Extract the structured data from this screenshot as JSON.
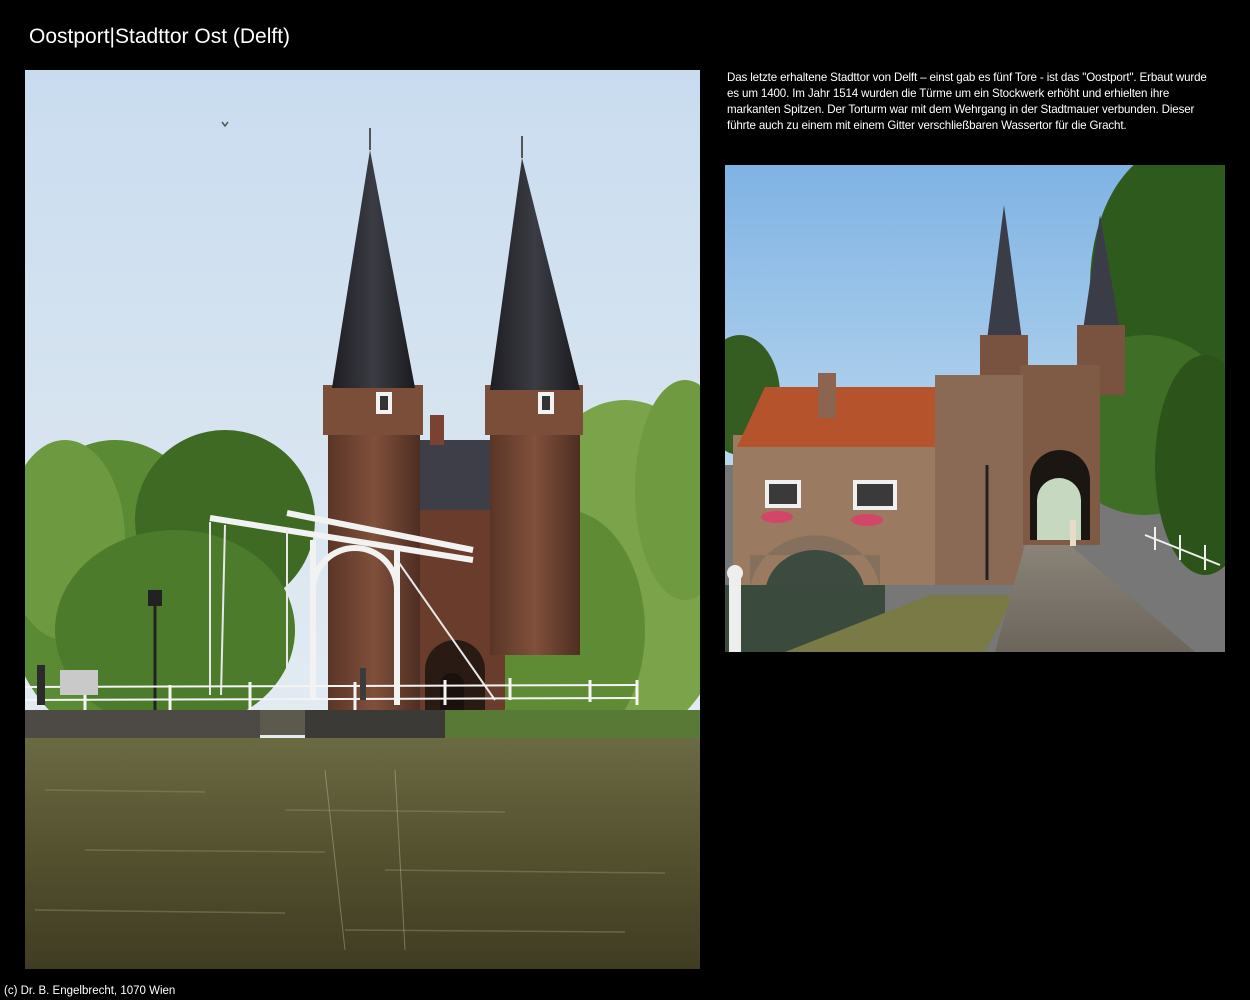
{
  "page": {
    "title": "Oostport|Stadttor Ost (Delft)"
  },
  "description": {
    "text": "Das letzte erhaltene Stadttor von Delft – einst gab es fünf Tore - ist das \"Oostport\". Erbaut wurde es um 1400. Im Jahr 1514 wurden die Türme um ein Stockwerk erhöht und erhielten ihre markanten Spitzen. Der Torturm war mit dem Wehrgang in der Stadtmauer verbunden. Dieser führte auch zu einem mit einem Gitter verschließbaren Wassertor für die Gracht."
  },
  "footer": {
    "copyright": "(c) Dr. B. Engelbrecht, 1070 Wien"
  },
  "colors": {
    "background": "#000000",
    "text": "#ffffff"
  }
}
